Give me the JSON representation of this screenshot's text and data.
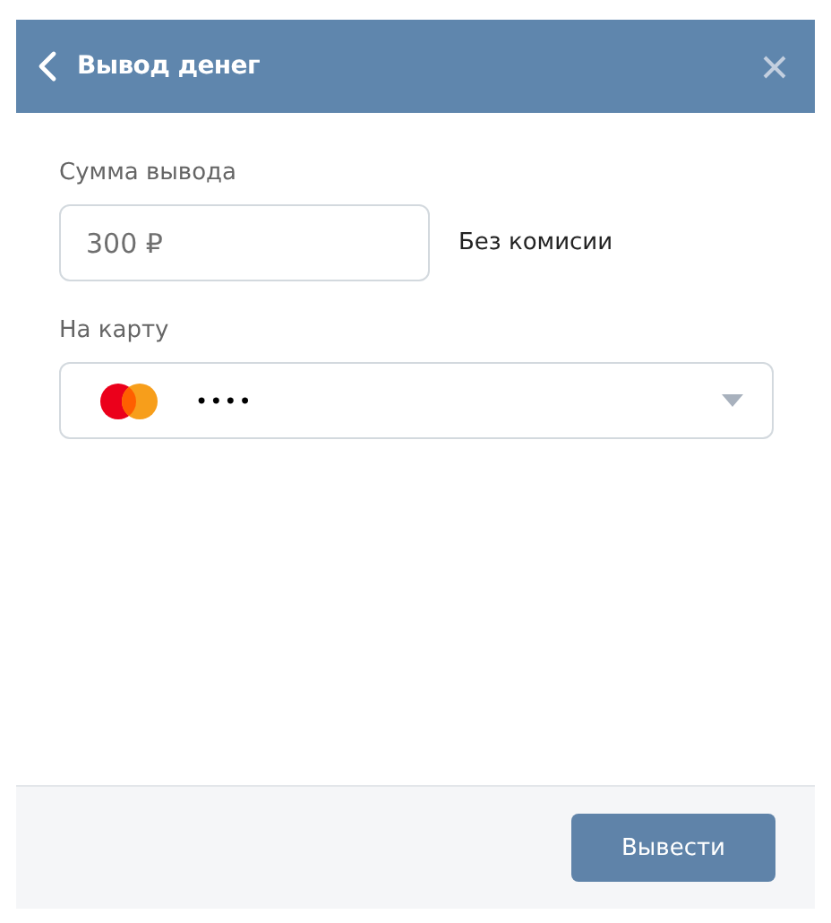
{
  "header": {
    "title": "Вывод денег"
  },
  "amount": {
    "label": "Сумма вывода",
    "value": "300 ₽",
    "note": "Без комисии"
  },
  "card": {
    "label": "На карту",
    "masked": "••••"
  },
  "footer": {
    "submit": "Вывести"
  }
}
